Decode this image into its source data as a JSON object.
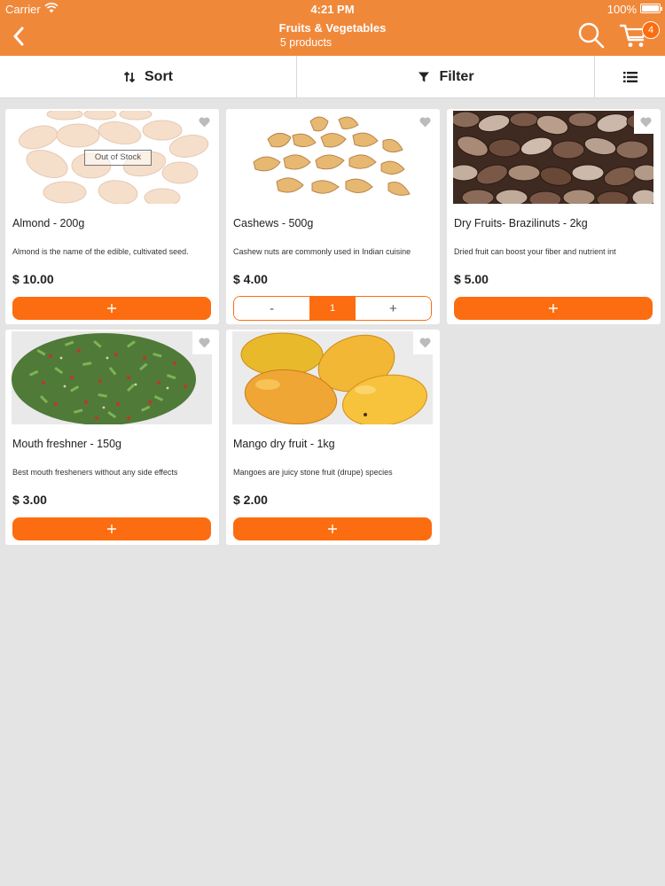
{
  "status_bar": {
    "carrier": "Carrier",
    "time": "4:21 PM",
    "battery": "100%"
  },
  "header": {
    "title": "Fruits & Vegetables",
    "subtitle": "5 products",
    "cart_count": "4",
    "accent_color": "#f0883a",
    "button_color": "#fb6d10"
  },
  "toolbar": {
    "sort_label": "Sort",
    "filter_label": "Filter"
  },
  "products": [
    {
      "name": "Almond - 200g",
      "description": "Almond is the name of the edible, cultivated seed.",
      "price": "$ 10.00",
      "badge": "Out of Stock",
      "image": "almonds"
    },
    {
      "name": "Cashews - 500g",
      "description": "Cashew nuts are commonly used in Indian cuisine",
      "price": "$ 4.00",
      "quantity": "1",
      "stepper_minus": "-",
      "stepper_plus": "+",
      "image": "cashews"
    },
    {
      "name": "Dry Fruits- Brazilinuts - 2kg",
      "description": "Dried fruit can boost your fiber and nutrient int",
      "price": "$ 5.00",
      "image": "brazil-nuts"
    },
    {
      "name": "Mouth freshner - 150g",
      "description": "Best mouth fresheners without any side effects",
      "price": "$ 3.00",
      "image": "mouth-freshener"
    },
    {
      "name": "Mango dry fruit - 1kg",
      "description": "Mangoes are juicy stone fruit (drupe) species",
      "price": "$ 2.00",
      "image": "mangoes"
    }
  ]
}
